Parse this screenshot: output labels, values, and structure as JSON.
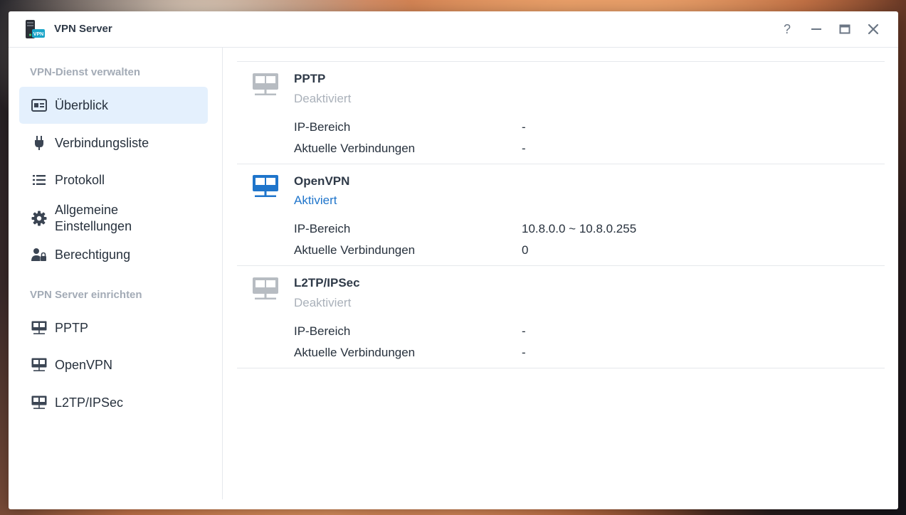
{
  "window": {
    "title": "VPN Server",
    "app_icon_badge": "VPN",
    "buttons": {
      "help": "?",
      "minimize": "–",
      "maximize": "▭",
      "close": "✕"
    }
  },
  "sidebar": {
    "section1_title": "VPN-Dienst verwalten",
    "section2_title": "VPN Server einrichten",
    "items": [
      {
        "label": "Überblick",
        "icon": "overview-icon",
        "active": true
      },
      {
        "label": "Verbindungsliste",
        "icon": "plug-icon"
      },
      {
        "label": "Protokoll",
        "icon": "list-icon"
      },
      {
        "label": "Allgemeine\nEinstellungen",
        "icon": "gear-icon"
      },
      {
        "label": "Berechtigung",
        "icon": "user-lock-icon"
      },
      {
        "label": "PPTP",
        "icon": "network-icon"
      },
      {
        "label": "OpenVPN",
        "icon": "network-icon"
      },
      {
        "label": "L2TP/IPSec",
        "icon": "network-icon"
      }
    ]
  },
  "services": [
    {
      "name": "PPTP",
      "status": "Deaktiviert",
      "enabled": false,
      "ip_label": "IP-Bereich",
      "ip_value": "-",
      "conn_label": "Aktuelle Verbindungen",
      "conn_value": "-"
    },
    {
      "name": "OpenVPN",
      "status": "Aktiviert",
      "enabled": true,
      "ip_label": "IP-Bereich",
      "ip_value": "10.8.0.0 ~ 10.8.0.255",
      "conn_label": "Aktuelle Verbindungen",
      "conn_value": "0"
    },
    {
      "name": "L2TP/IPSec",
      "status": "Deaktiviert",
      "enabled": false,
      "ip_label": "IP-Bereich",
      "ip_value": "-",
      "conn_label": "Aktuelle Verbindungen",
      "conn_value": "-"
    }
  ],
  "colors": {
    "accent": "#1f75cb",
    "active_bg": "#e4f0fd",
    "disabled_icon": "#b7bcc2",
    "enabled_icon": "#1f75cb"
  }
}
